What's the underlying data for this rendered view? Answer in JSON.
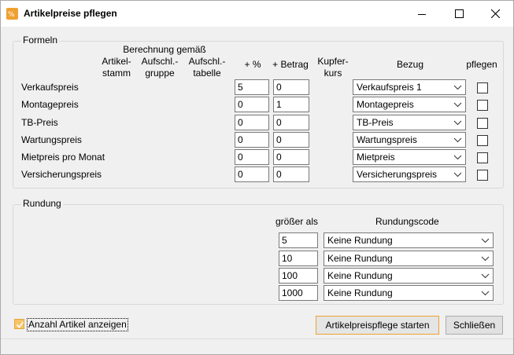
{
  "window": {
    "title": "Artikelpreise pflegen"
  },
  "formeln": {
    "title": "Formeln",
    "headers": {
      "berechnung": "Berechnung gemäß",
      "artikelstamm": [
        "Artikel-",
        "stamm"
      ],
      "aufschlgruppe": [
        "Aufschl.-",
        "gruppe"
      ],
      "aufschltabelle": [
        "Aufschl.-",
        "tabelle"
      ],
      "prozent": "+ %",
      "betrag": "+ Betrag",
      "kupferkurs": [
        "Kupfer-",
        "kurs"
      ],
      "bezug": "Bezug",
      "pflegen": "pflegen"
    },
    "rows": [
      {
        "label": "Verkaufspreis",
        "prozent": "5",
        "betrag": "0",
        "bezug": "Verkaufspreis 1"
      },
      {
        "label": "Montagepreis",
        "prozent": "0",
        "betrag": "1",
        "bezug": "Montagepreis"
      },
      {
        "label": "TB-Preis",
        "prozent": "0",
        "betrag": "0",
        "bezug": "TB-Preis"
      },
      {
        "label": "Wartungspreis",
        "prozent": "0",
        "betrag": "0",
        "bezug": "Wartungspreis"
      },
      {
        "label": "Mietpreis pro Monat",
        "prozent": "0",
        "betrag": "0",
        "bezug": "Mietpreis"
      },
      {
        "label": "Versicherungspreis",
        "prozent": "0",
        "betrag": "0",
        "bezug": "Versicherungspreis"
      }
    ]
  },
  "rundung": {
    "title": "Rundung",
    "col_groesser": "größer als",
    "col_code": "Rundungscode",
    "rows": [
      {
        "groesser": "5",
        "code": "Keine Rundung"
      },
      {
        "groesser": "10",
        "code": "Keine Rundung"
      },
      {
        "groesser": "100",
        "code": "Keine Rundung"
      },
      {
        "groesser": "1000",
        "code": "Keine Rundung"
      }
    ]
  },
  "footer": {
    "anzahl_label": "Anzahl Artikel anzeigen",
    "anzahl_checked": true,
    "start_label": "Artikelpreispflege starten",
    "close_label": "Schließen"
  },
  "colors": {
    "accent": "#f0a030",
    "checkbox_fill": "#f7c46a"
  }
}
